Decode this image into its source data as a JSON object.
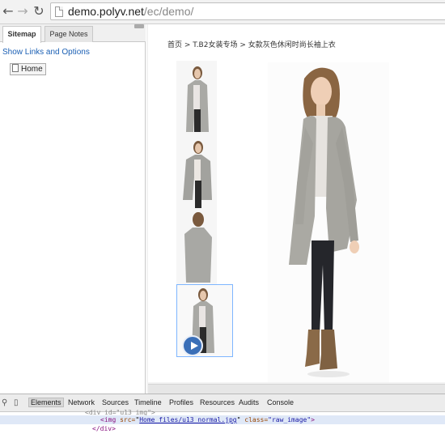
{
  "browser": {
    "url_host": "demo.polyv.net",
    "url_path": "/ec/demo/",
    "back_icon": "back-arrow-icon",
    "forward_icon": "forward-arrow-icon",
    "reload_icon": "reload-icon"
  },
  "sidebar": {
    "tabs": [
      "Sitemap",
      "Page Notes"
    ],
    "active_tab": "Sitemap",
    "show_links": "Show Links and Options",
    "tree": [
      {
        "label": "Home"
      }
    ]
  },
  "page": {
    "breadcrumb": "首页 > T.B2女装专场 > 女款灰色休闲时尚长袖上衣",
    "thumbnails": [
      "thumbnail-1",
      "thumbnail-2",
      "thumbnail-3",
      "thumbnail-4"
    ],
    "selected_thumbnail": 4
  },
  "devtools": {
    "tabs": [
      "Elements",
      "Network",
      "Sources",
      "Timeline",
      "Profiles",
      "Resources",
      "Audits",
      "Console"
    ],
    "active_tab": "Elements",
    "code": {
      "line1": "<div id=\"u13_img\">",
      "line2_tag_open": "<img",
      "line2_attr_src": "src=",
      "line2_src": "Home_files/u13_normal.jpg",
      "line2_attr_class": "class=",
      "line2_class": "\"raw_image\"",
      "line2_close": ">",
      "line3": "</div>"
    }
  },
  "colors": {
    "link": "#1a5fb4",
    "selected_outline": "#7eb6ff",
    "devtools_highlight": "#dfe8f7"
  }
}
